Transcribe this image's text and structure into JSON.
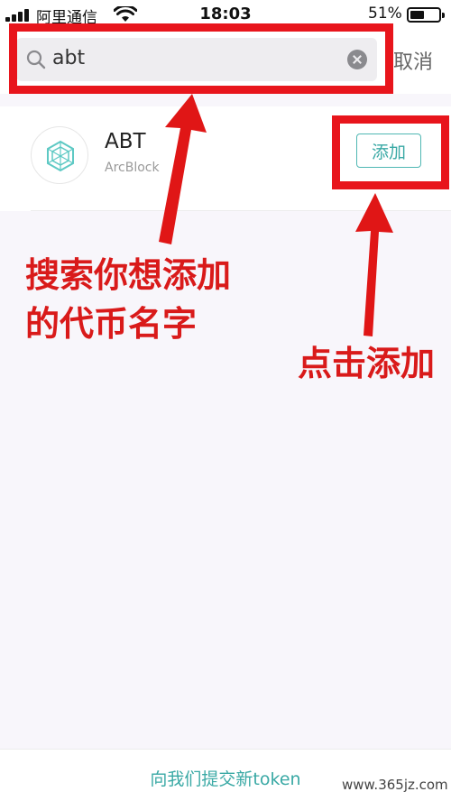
{
  "status_bar": {
    "carrier": "阿里通信",
    "time": "18:03",
    "battery_pct": "51%",
    "battery_level": 0.51,
    "icons": [
      "signal-icon",
      "wifi-icon",
      "battery-icon"
    ]
  },
  "search": {
    "value": "abt",
    "cancel_label": "取消",
    "icons": [
      "search-icon",
      "clear-icon"
    ]
  },
  "result": {
    "symbol": "ABT",
    "name": "ArcBlock",
    "add_label": "添加",
    "logo_icon": "arcblock-logo-icon"
  },
  "annotations": {
    "search_line1": "搜索你想添加",
    "search_line2": "的代币名字",
    "add_hint": "点击添加",
    "highlight_color": "#e8151c"
  },
  "footer": {
    "link_label": "向我们提交新token"
  },
  "watermark": "www.365jz.com",
  "colors": {
    "accent": "#3aa9a5",
    "annotation_red": "#d91a1a",
    "background": "#f8f6fb"
  }
}
